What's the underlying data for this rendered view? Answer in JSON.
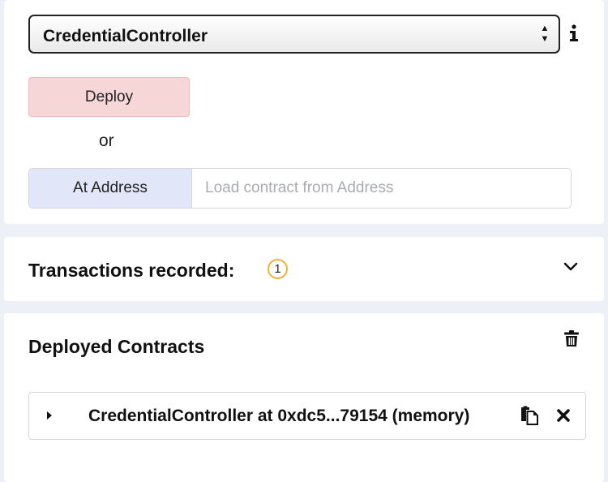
{
  "deploy_panel": {
    "contract_select": {
      "selected": "CredentialController",
      "arrows_icon": "sort-arrows-icon"
    },
    "info_icon": "info-icon",
    "deploy_label": "Deploy",
    "or_label": "or",
    "at_address_label": "At Address",
    "address_placeholder": "Load contract from Address",
    "colors": {
      "deploy_bg": "#f6d6d6",
      "at_address_bg": "#e2e6f9"
    }
  },
  "transactions": {
    "title": "Transactions recorded:",
    "count": "1",
    "toggle_icon": "chevron-down-icon",
    "badge_color": "#f0b23a"
  },
  "deployed": {
    "title": "Deployed Contracts",
    "clear_icon": "trash-icon",
    "instances": [
      {
        "label": "CredentialController at 0xdc5...79154 (memory)",
        "expand_icon": "caret-right-icon",
        "copy_icon": "copy-icon",
        "remove_icon": "close-icon"
      }
    ]
  }
}
